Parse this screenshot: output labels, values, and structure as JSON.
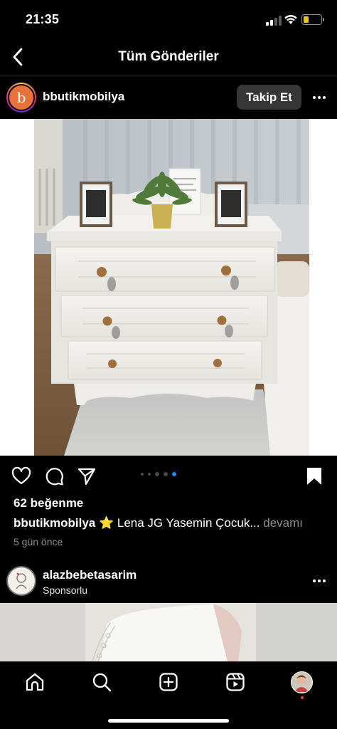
{
  "status_bar": {
    "time": "21:35",
    "icons": [
      "signal-icon",
      "wifi-icon",
      "battery-icon"
    ],
    "battery_color": "#f7c600"
  },
  "header": {
    "back_icon": "chevron-left-icon",
    "title": "Tüm Gönderiler"
  },
  "post": {
    "avatar_letter": "b",
    "username": "bbutikmobilya",
    "follow_label": "Takip Et",
    "more_icon": "ellipsis-icon",
    "image_description_icon": "photo",
    "actions": [
      "heart-icon",
      "comment-icon",
      "share-icon",
      "bookmark-icon"
    ],
    "carousel": {
      "total": 5,
      "active": 5
    },
    "likes": "62 beğenme",
    "caption_user": "bbutikmobilya",
    "caption_text": "⭐ Lena JG Yasemin Çocuk...",
    "caption_more": "devamı",
    "timestamp": "5 gün önce"
  },
  "sponsored": {
    "username": "alazbebetasarim",
    "label": "Sponsorlu",
    "more_icon": "ellipsis-icon"
  },
  "tab_bar": {
    "tabs": [
      "home-icon",
      "search-icon",
      "create-icon",
      "reels-icon",
      "profile-avatar"
    ],
    "notification_color": "#ff3040"
  }
}
